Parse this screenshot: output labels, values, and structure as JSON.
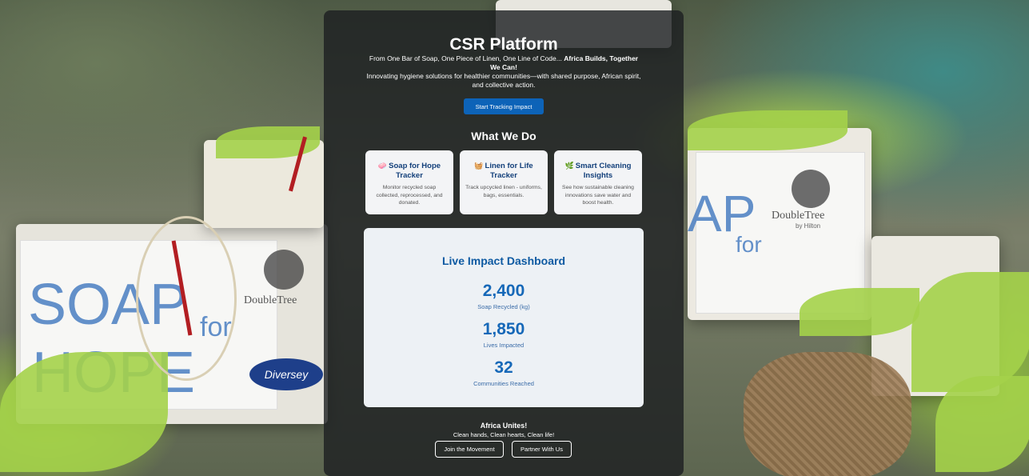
{
  "header": {
    "title": "CSR Platform",
    "tagline_lead": "From One Bar of Soap, One Piece of Linen, One Line of Code...",
    "tagline_bold": "Africa Builds, Together We Can!",
    "subtitle": "Innovating hygiene solutions for healthier communities—with shared purpose, African spirit, and collective action.",
    "cta_label": "Start Tracking Impact"
  },
  "what_we_do": {
    "title": "What We Do",
    "cards": [
      {
        "icon": "soap-icon",
        "glyph": "🧼",
        "title": "Soap for Hope Tracker",
        "desc": "Monitor recycled soap collected, reprocessed, and donated."
      },
      {
        "icon": "linen-icon",
        "glyph": "🧺",
        "title": "Linen for Life Tracker",
        "desc": "Track upcycled linen - uniforms, bags, essentials."
      },
      {
        "icon": "leaf-icon",
        "glyph": "🌿",
        "title": "Smart Cleaning Insights",
        "desc": "See how sustainable cleaning innovations save water and boost health."
      }
    ]
  },
  "dashboard": {
    "title": "Live Impact Dashboard",
    "stats": [
      {
        "value": "2,400",
        "label": "Soap Recycled (kg)"
      },
      {
        "value": "1,850",
        "label": "Lives Impacted"
      },
      {
        "value": "32",
        "label": "Communities Reached"
      }
    ]
  },
  "footer": {
    "title": "Africa Unites!",
    "subtitle": "Clean hands, Clean hearts, Clean life!",
    "join_label": "Join the Movement",
    "partner_label": "Partner With Us"
  },
  "background": {
    "soap_text_1": "SOAP",
    "soap_text_2": "for",
    "soap_text_3": "HOPE",
    "brand": "DoubleTree",
    "brand_sub": "by Hilton",
    "partner": "Diversey"
  },
  "colors": {
    "accent": "#0d63b8",
    "card_title": "#123f7a",
    "stat": "#1668b8"
  }
}
